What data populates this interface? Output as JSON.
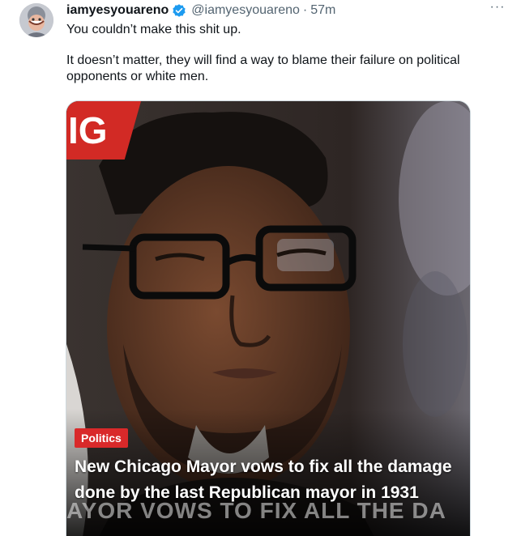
{
  "tweet": {
    "author_name": "iamyesyouareno",
    "handle": "@iamyesyouareno",
    "separator": "·",
    "timestamp": "57m",
    "more_label": "···",
    "paragraphs": [
      "You couldn’t make this shit up.",
      "It doesn’t matter, they will find a way to blame their failure on political opponents or white men."
    ]
  },
  "media": {
    "brand_fragment": "IG",
    "category_label": "Politics",
    "headline": "New Chicago Mayor vows to fix all the damage done by the last Republican mayor in 1931",
    "background_caption": "AYOR VOWS TO FIX ALL THE DA"
  },
  "colors": {
    "verified_badge": "#1d9bf0",
    "category_tag": "#d9292a",
    "brand_tag": "#d22a25",
    "secondary_text": "#536471"
  },
  "icons": {
    "verified": "verified-badge-icon",
    "more": "more-options-icon"
  }
}
